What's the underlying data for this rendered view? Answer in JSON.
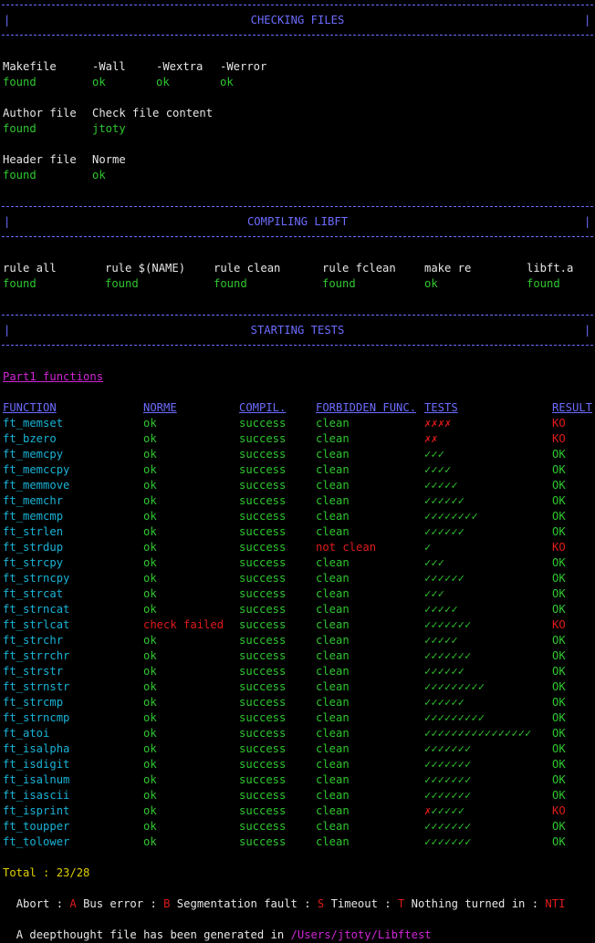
{
  "sections": {
    "checking": "CHECKING FILES",
    "compiling": "COMPILING LIBFT",
    "starting": "STARTING TESTS",
    "bar_char": "|"
  },
  "checks": [
    {
      "label": "Makefile",
      "value": "found"
    },
    {
      "label": "-Wall",
      "value": "ok"
    },
    {
      "label": "-Wextra",
      "value": "ok"
    },
    {
      "label": "-Werror",
      "value": "ok"
    },
    {
      "label": "Author file",
      "value": "found"
    },
    {
      "label": "Check file content",
      "value": "jtoty"
    },
    {
      "label": "Header file",
      "value": "found"
    },
    {
      "label": "Norme",
      "value": "ok"
    }
  ],
  "compile": [
    {
      "label": "rule all",
      "value": "found"
    },
    {
      "label": "rule $(NAME)",
      "value": "found"
    },
    {
      "label": "rule clean",
      "value": "found"
    },
    {
      "label": "rule fclean",
      "value": "found"
    },
    {
      "label": "make re",
      "value": "ok"
    },
    {
      "label": "libft.a",
      "value": "found"
    }
  ],
  "part_label": "Part1 functions",
  "headers": {
    "function": "FUNCTION",
    "norme": "NORME",
    "compil": "COMPIL.",
    "forbidden": "FORBIDDEN FUNC.",
    "tests": "TESTS",
    "result": "RESULT"
  },
  "rows": [
    {
      "fn": "ft_memset",
      "norme": "ok",
      "compil": "success",
      "forbidden": "clean",
      "fail": "✗✗✗✗",
      "pass": "",
      "result": "KO"
    },
    {
      "fn": "ft_bzero",
      "norme": "ok",
      "compil": "success",
      "forbidden": "clean",
      "fail": "✗✗",
      "pass": "",
      "result": "KO"
    },
    {
      "fn": "ft_memcpy",
      "norme": "ok",
      "compil": "success",
      "forbidden": "clean",
      "fail": "",
      "pass": "✓✓✓",
      "result": "OK"
    },
    {
      "fn": "ft_memccpy",
      "norme": "ok",
      "compil": "success",
      "forbidden": "clean",
      "fail": "",
      "pass": "✓✓✓✓",
      "result": "OK"
    },
    {
      "fn": "ft_memmove",
      "norme": "ok",
      "compil": "success",
      "forbidden": "clean",
      "fail": "",
      "pass": "✓✓✓✓✓",
      "result": "OK"
    },
    {
      "fn": "ft_memchr",
      "norme": "ok",
      "compil": "success",
      "forbidden": "clean",
      "fail": "",
      "pass": "✓✓✓✓✓✓",
      "result": "OK"
    },
    {
      "fn": "ft_memcmp",
      "norme": "ok",
      "compil": "success",
      "forbidden": "clean",
      "fail": "",
      "pass": "✓✓✓✓✓✓✓✓",
      "result": "OK"
    },
    {
      "fn": "ft_strlen",
      "norme": "ok",
      "compil": "success",
      "forbidden": "clean",
      "fail": "",
      "pass": "✓✓✓✓✓✓",
      "result": "OK"
    },
    {
      "fn": "ft_strdup",
      "norme": "ok",
      "compil": "success",
      "forbidden": "not clean",
      "fail": "",
      "pass": "✓",
      "result": "KO"
    },
    {
      "fn": "ft_strcpy",
      "norme": "ok",
      "compil": "success",
      "forbidden": "clean",
      "fail": "",
      "pass": "✓✓✓",
      "result": "OK"
    },
    {
      "fn": "ft_strncpy",
      "norme": "ok",
      "compil": "success",
      "forbidden": "clean",
      "fail": "",
      "pass": "✓✓✓✓✓✓",
      "result": "OK"
    },
    {
      "fn": "ft_strcat",
      "norme": "ok",
      "compil": "success",
      "forbidden": "clean",
      "fail": "",
      "pass": "✓✓✓",
      "result": "OK"
    },
    {
      "fn": "ft_strncat",
      "norme": "ok",
      "compil": "success",
      "forbidden": "clean",
      "fail": "",
      "pass": "✓✓✓✓✓",
      "result": "OK"
    },
    {
      "fn": "ft_strlcat",
      "norme": "check failed",
      "compil": "success",
      "forbidden": "clean",
      "fail": "",
      "pass": "✓✓✓✓✓✓✓",
      "result": "KO"
    },
    {
      "fn": "ft_strchr",
      "norme": "ok",
      "compil": "success",
      "forbidden": "clean",
      "fail": "",
      "pass": "✓✓✓✓✓",
      "result": "OK"
    },
    {
      "fn": "ft_strrchr",
      "norme": "ok",
      "compil": "success",
      "forbidden": "clean",
      "fail": "",
      "pass": "✓✓✓✓✓✓✓",
      "result": "OK"
    },
    {
      "fn": "ft_strstr",
      "norme": "ok",
      "compil": "success",
      "forbidden": "clean",
      "fail": "",
      "pass": "✓✓✓✓✓✓",
      "result": "OK"
    },
    {
      "fn": "ft_strnstr",
      "norme": "ok",
      "compil": "success",
      "forbidden": "clean",
      "fail": "",
      "pass": "✓✓✓✓✓✓✓✓✓",
      "result": "OK"
    },
    {
      "fn": "ft_strcmp",
      "norme": "ok",
      "compil": "success",
      "forbidden": "clean",
      "fail": "",
      "pass": "✓✓✓✓✓✓",
      "result": "OK"
    },
    {
      "fn": "ft_strncmp",
      "norme": "ok",
      "compil": "success",
      "forbidden": "clean",
      "fail": "",
      "pass": "✓✓✓✓✓✓✓✓✓",
      "result": "OK"
    },
    {
      "fn": "ft_atoi",
      "norme": "ok",
      "compil": "success",
      "forbidden": "clean",
      "fail": "",
      "pass": "✓✓✓✓✓✓✓✓✓✓✓✓✓✓✓✓",
      "result": "OK"
    },
    {
      "fn": "ft_isalpha",
      "norme": "ok",
      "compil": "success",
      "forbidden": "clean",
      "fail": "",
      "pass": "✓✓✓✓✓✓✓",
      "result": "OK"
    },
    {
      "fn": "ft_isdigit",
      "norme": "ok",
      "compil": "success",
      "forbidden": "clean",
      "fail": "",
      "pass": "✓✓✓✓✓✓✓",
      "result": "OK"
    },
    {
      "fn": "ft_isalnum",
      "norme": "ok",
      "compil": "success",
      "forbidden": "clean",
      "fail": "",
      "pass": "✓✓✓✓✓✓✓",
      "result": "OK"
    },
    {
      "fn": "ft_isascii",
      "norme": "ok",
      "compil": "success",
      "forbidden": "clean",
      "fail": "",
      "pass": "✓✓✓✓✓✓✓",
      "result": "OK"
    },
    {
      "fn": "ft_isprint",
      "norme": "ok",
      "compil": "success",
      "forbidden": "clean",
      "fail": "✗",
      "pass": "✓✓✓✓✓",
      "result": "KO"
    },
    {
      "fn": "ft_toupper",
      "norme": "ok",
      "compil": "success",
      "forbidden": "clean",
      "fail": "",
      "pass": "✓✓✓✓✓✓✓",
      "result": "OK"
    },
    {
      "fn": "ft_tolower",
      "norme": "ok",
      "compil": "success",
      "forbidden": "clean",
      "fail": "",
      "pass": "✓✓✓✓✓✓✓",
      "result": "OK"
    }
  ],
  "total": "Total : 23/28",
  "legend": {
    "abort": "Abort : ",
    "a": "A",
    "bus": " Bus error : ",
    "b": "B",
    "seg": " Segmentation fault : ",
    "s": "S",
    "timeout": " Timeout : ",
    "t": "T",
    "nothing": " Nothing turned in : ",
    "nti": "NTI"
  },
  "footer": {
    "text": "A deepthought file has been generated in ",
    "path": "/Users/jtoty/Libftest"
  },
  "colors": {
    "green": "#2fc72f",
    "red": "#e01b1b",
    "cyan": "#19b3d6",
    "blue": "#6c6cff",
    "magenta": "#d026d6",
    "yellow": "#e0d000"
  }
}
